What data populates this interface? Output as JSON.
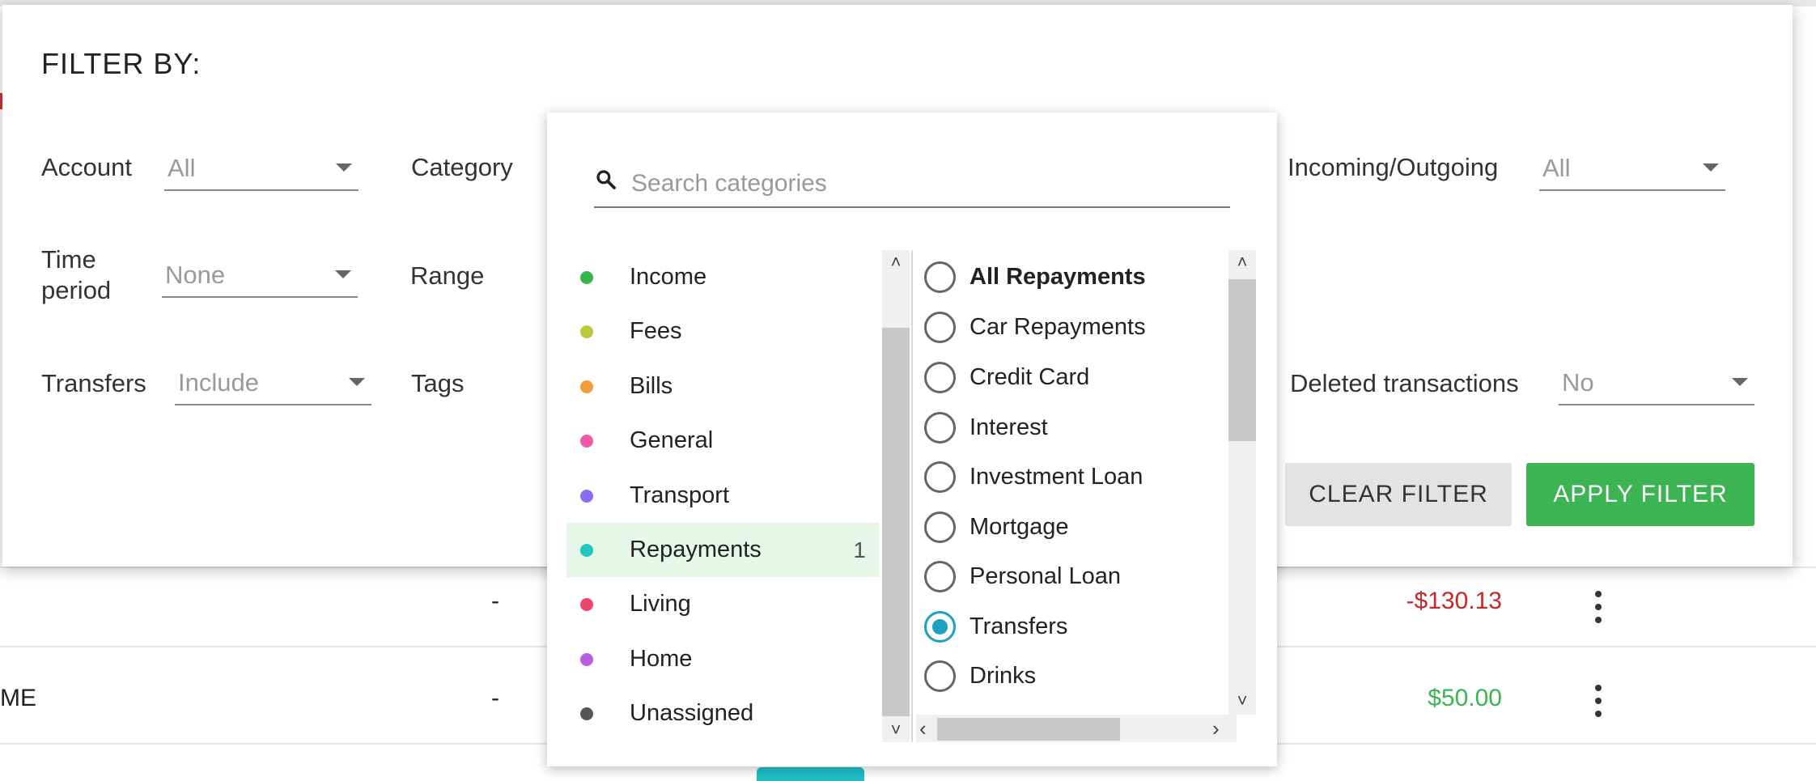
{
  "background": {
    "rows": [
      {
        "dash": "-",
        "amount": "-$130.13",
        "amount_color": "#c62828"
      },
      {
        "prefix": "ME",
        "dash": "-",
        "amount": "$50.00",
        "amount_color": "#3cb454"
      }
    ]
  },
  "filter": {
    "title": "FILTER BY:",
    "account": {
      "label": "Account",
      "value": "All"
    },
    "category": {
      "label": "Category"
    },
    "incoming_outgoing": {
      "label": "Incoming/Outgoing",
      "value": "All"
    },
    "time_period": {
      "label": "Time period",
      "value": "None"
    },
    "range": {
      "label": "Range"
    },
    "transfers": {
      "label": "Transfers",
      "value": "Include"
    },
    "tags": {
      "label": "Tags"
    },
    "deleted": {
      "label": "Deleted transactions",
      "value": "No"
    },
    "clear_label": "CLEAR FILTER",
    "apply_label": "APPLY FILTER"
  },
  "category_dropdown": {
    "search_placeholder": "Search categories",
    "categories": [
      {
        "label": "Income",
        "color": "#35b54a",
        "count": ""
      },
      {
        "label": "Fees",
        "color": "#b8c93a",
        "count": ""
      },
      {
        "label": "Bills",
        "color": "#f39a3a",
        "count": ""
      },
      {
        "label": "General",
        "color": "#f25aa8",
        "count": ""
      },
      {
        "label": "Transport",
        "color": "#8c6cf0",
        "count": ""
      },
      {
        "label": "Repayments",
        "color": "#22c5c0",
        "count": "1"
      },
      {
        "label": "Living",
        "color": "#f0436a",
        "count": ""
      },
      {
        "label": "Home",
        "color": "#b85ee0",
        "count": ""
      },
      {
        "label": "Unassigned",
        "color": "#555555",
        "count": ""
      }
    ],
    "subcategories": [
      {
        "label": "All Repayments",
        "checked": false
      },
      {
        "label": "Car Repayments",
        "checked": false
      },
      {
        "label": "Credit Card",
        "checked": false
      },
      {
        "label": "Interest",
        "checked": false
      },
      {
        "label": "Investment Loan",
        "checked": false
      },
      {
        "label": "Mortgage",
        "checked": false
      },
      {
        "label": "Personal Loan",
        "checked": false
      },
      {
        "label": "Transfers",
        "checked": true
      },
      {
        "label": "Drinks",
        "checked": false
      }
    ]
  }
}
